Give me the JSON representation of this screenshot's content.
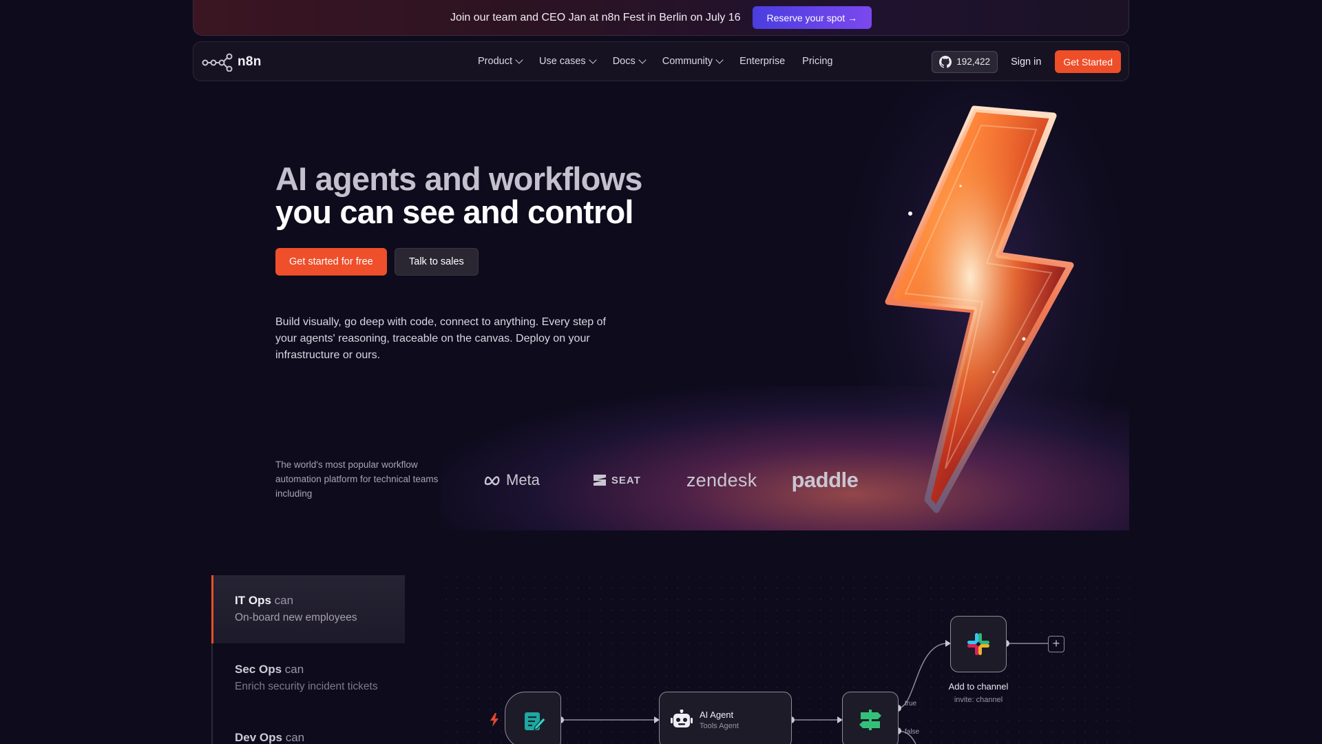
{
  "banner": {
    "text": "Join our team and CEO Jan at n8n Fest in Berlin on July 16",
    "cta": "Reserve your spot →"
  },
  "nav": {
    "logo_text": "n8n",
    "links": [
      {
        "label": "Product"
      },
      {
        "label": "Use cases"
      },
      {
        "label": "Docs"
      },
      {
        "label": "Community"
      },
      {
        "label": "Enterprise"
      },
      {
        "label": "Pricing"
      }
    ],
    "github_stars": "192,422",
    "signin": "Sign in",
    "get_started": "Get Started"
  },
  "hero": {
    "title_line1": "AI agents and workflows",
    "title_line2": "you can see and control",
    "primary_cta": "Get started for free",
    "secondary_cta": "Talk to sales",
    "description": "Build visually, go deep with code, connect to anything. Every step of your agents' reasoning, traceable on the canvas. Deploy on your infrastructure or ours.",
    "trust_text": "The world's most popular workflow automation platform for technical teams including",
    "customer_logos": [
      "Meta",
      "SEAT",
      "zendesk",
      "paddle"
    ]
  },
  "use_cases": [
    {
      "team": "IT Ops",
      "can": "can",
      "task": "On-board new employees",
      "active": true
    },
    {
      "team": "Sec Ops",
      "can": "can",
      "task": "Enrich security incident tickets",
      "active": false
    },
    {
      "team": "Dev Ops",
      "can": "can",
      "task": "",
      "active": false
    }
  ],
  "workflow": {
    "agent_title": "AI Agent",
    "agent_sub": "Tools Agent",
    "branch_true": "true",
    "branch_false": "false",
    "slack_title": "Add to channel",
    "slack_sub": "invite: channel",
    "plus": "+"
  },
  "colors": {
    "background": "#0e0b1d",
    "accent": "#ee4e28",
    "banner_cta": "#5b43e6"
  }
}
